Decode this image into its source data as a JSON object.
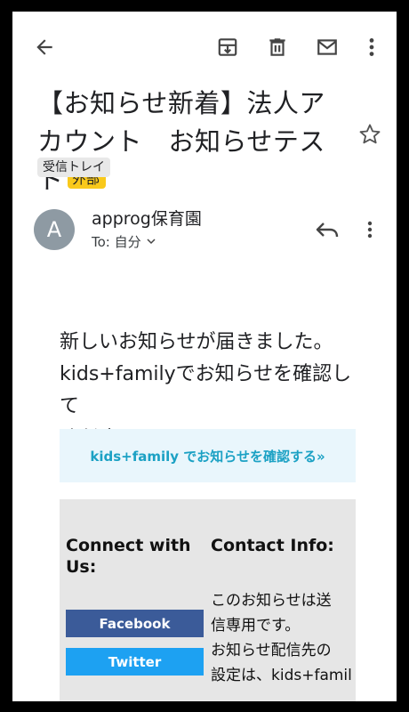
{
  "email": {
    "subject": "【お知らせ新着】法人アカウント　お知らせテスト",
    "external_badge": "外部",
    "label": "受信トレイ",
    "sender": {
      "avatar_letter": "A",
      "name": "approg保育園",
      "to": "To: 自分"
    },
    "body": {
      "lines": [
        "新しいお知らせが届きました。",
        "kids+familyでお知らせを確認して",
        "ください。"
      ],
      "cta": "kids+family でお知らせを確認する»"
    },
    "footer": {
      "connect_title": "Connect with Us:",
      "facebook": "Facebook",
      "twitter": "Twitter",
      "contact_title": "Contact Info:",
      "contact_lines": [
        "このお知らせは送",
        "信専用です。",
        "お知らせ配信先の",
        "設定は、kids+famil"
      ]
    }
  },
  "colors": {
    "badge": "#f9c91b",
    "cta_bg": "#e9f6fc",
    "cta_text": "#1ba1c4",
    "facebook": "#3b5b99",
    "twitter": "#1da1f2",
    "avatar": "#8e9aa3"
  },
  "icons": [
    "back-arrow-icon",
    "archive-icon",
    "delete-icon",
    "mail-icon",
    "more-vert-icon",
    "star-icon",
    "reply-icon",
    "chevron-down-icon"
  ]
}
